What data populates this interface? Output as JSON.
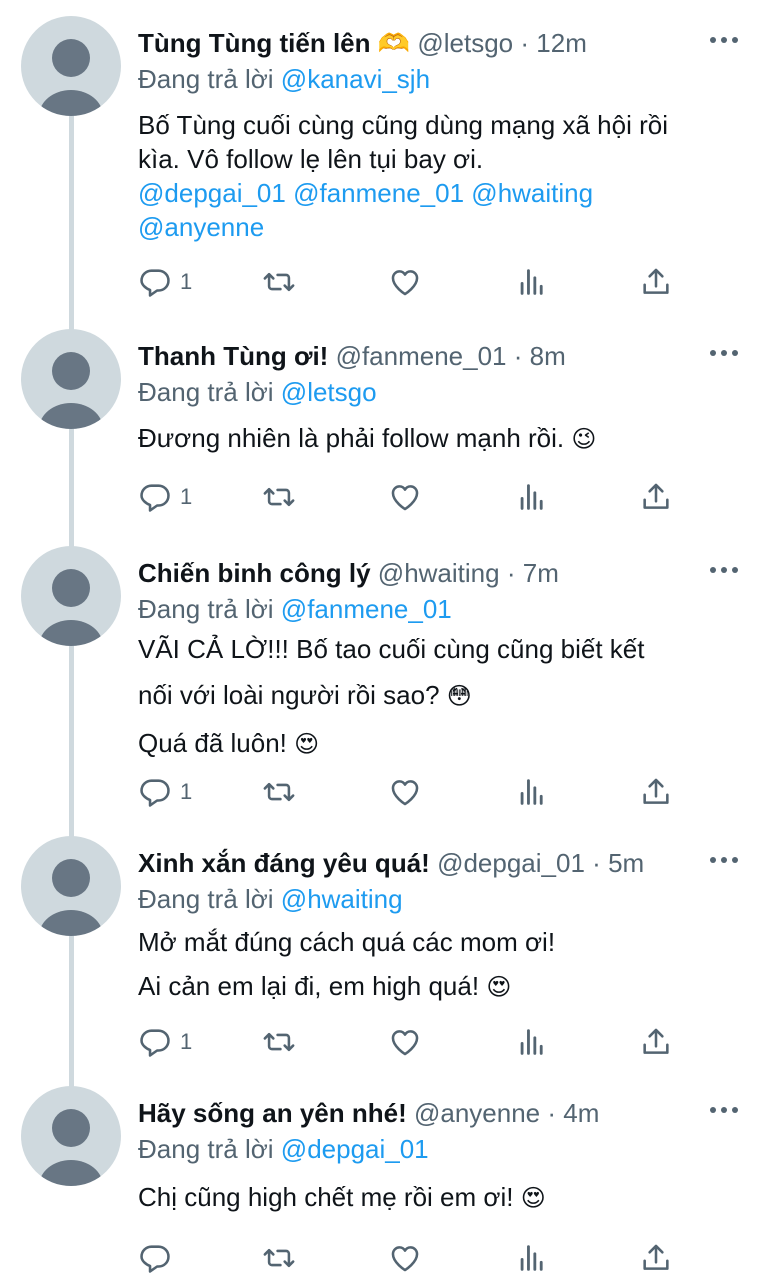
{
  "tweets": [
    {
      "name": "Tùng Tùng tiến lên 🫶",
      "handle": "@letsgo",
      "time": "12m",
      "replying_label": "Đang trả lời",
      "replying_to": "@kanavi_sjh",
      "lines": [
        "Bố Tùng cuối cùng cũng dùng mạng xã hội rồi",
        "kìa. Vô follow lẹ lên tụi bay ơi."
      ],
      "mentions": [
        "@depgai_01",
        "@fanmene_01",
        "@hwaiting",
        "@anyenne"
      ],
      "reply_count": "1"
    },
    {
      "name": "Thanh Tùng ơi!",
      "handle": "@fanmene_01",
      "time": "8m",
      "replying_label": "Đang trả lời",
      "replying_to": "@letsgo",
      "lines": [
        "Đương nhiên là phải follow mạnh rồi."
      ],
      "emoji": "😉",
      "reply_count": "1"
    },
    {
      "name": "Chiến binh công lý",
      "handle": "@hwaiting",
      "time": "7m",
      "replying_label": "Đang trả lời",
      "replying_to": "@fanmene_01",
      "lines": [
        "VÃI CẢ LỜ!!! Bố tao cuối cùng cũng biết kết",
        "nối với loài người rồi sao?",
        "Quá đã luôn!"
      ],
      "emojis": [
        "😳",
        "😍"
      ],
      "reply_count": "1"
    },
    {
      "name": "Xinh xắn đáng yêu quá!",
      "handle": "@depgai_01",
      "time": "5m",
      "replying_label": "Đang trả lời",
      "replying_to": "@hwaiting",
      "lines": [
        "Mở mắt đúng cách quá các mom ơi!",
        "Ai cản em lại đi, em high quá!"
      ],
      "emoji": "😍",
      "reply_count": "1"
    },
    {
      "name": "Hãy sống an yên nhé!",
      "handle": "@anyenne",
      "time": "4m",
      "replying_label": "Đang trả lời",
      "replying_to": "@depgai_01",
      "lines": [
        "Chị cũng high chết mẹ rồi em ơi!"
      ],
      "emoji": "😍",
      "reply_count": ""
    }
  ],
  "separator": "·",
  "icons": {
    "reply": "reply-icon",
    "retweet": "retweet-icon",
    "like": "like-icon",
    "views": "views-icon",
    "share": "share-icon",
    "more": "more-icon"
  },
  "colors": {
    "link": "#1d9bf0",
    "secondary": "#536471",
    "avatar_bg": "#cfd9de",
    "avatar_fg": "#687684"
  }
}
